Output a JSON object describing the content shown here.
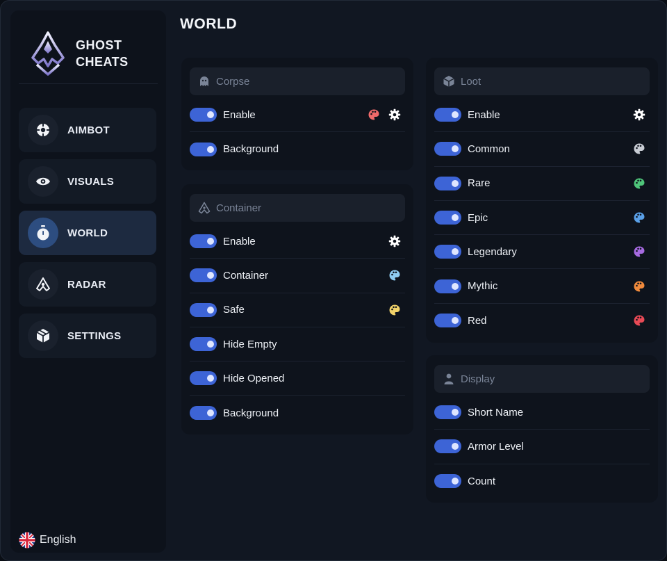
{
  "brand": {
    "line1": "GHOST",
    "line2": "CHEATS"
  },
  "nav": [
    {
      "label": "AIMBOT",
      "icon": "crosshair-icon",
      "active": false
    },
    {
      "label": "VISUALS",
      "icon": "eye-icon",
      "active": false
    },
    {
      "label": "WORLD",
      "icon": "timer-icon",
      "active": true
    },
    {
      "label": "RADAR",
      "icon": "radar-icon",
      "active": false
    },
    {
      "label": "SETTINGS",
      "icon": "cube-icon",
      "active": false
    }
  ],
  "language": {
    "label": "English",
    "icon": "uk-flag-icon"
  },
  "page": {
    "title": "WORLD"
  },
  "colors": {
    "accent": "#3d64d6",
    "active_nav": "#1d2a40"
  },
  "corpse": {
    "title": "Corpse",
    "icon": "ghost-icon",
    "rows": [
      {
        "label": "Enable",
        "on": true,
        "palette": "#f06a6a",
        "gear": true
      },
      {
        "label": "Background",
        "on": true
      }
    ]
  },
  "container": {
    "title": "Container",
    "icon": "radar-icon",
    "rows": [
      {
        "label": "Enable",
        "on": true,
        "gear": true
      },
      {
        "label": "Container",
        "on": true,
        "palette": "#8fcdf2"
      },
      {
        "label": "Safe",
        "on": true,
        "palette": "#f2d36a"
      },
      {
        "label": "Hide Empty",
        "on": true
      },
      {
        "label": "Hide Opened",
        "on": true
      },
      {
        "label": "Background",
        "on": true
      }
    ]
  },
  "loot": {
    "title": "Loot",
    "icon": "cube-icon",
    "rows": [
      {
        "label": "Enable",
        "on": true,
        "gear": true
      },
      {
        "label": "Common",
        "on": true,
        "palette": "#c8ccd4"
      },
      {
        "label": "Rare",
        "on": true,
        "palette": "#4fc57a"
      },
      {
        "label": "Epic",
        "on": true,
        "palette": "#5aa0e8"
      },
      {
        "label": "Legendary",
        "on": true,
        "palette": "#a66ae0"
      },
      {
        "label": "Mythic",
        "on": true,
        "palette": "#f08a3c"
      },
      {
        "label": "Red",
        "on": true,
        "palette": "#e84a56"
      }
    ]
  },
  "display": {
    "title": "Display",
    "icon": "person-icon",
    "rows": [
      {
        "label": "Short Name",
        "on": true
      },
      {
        "label": "Armor Level",
        "on": true
      },
      {
        "label": "Count",
        "on": true
      }
    ]
  }
}
